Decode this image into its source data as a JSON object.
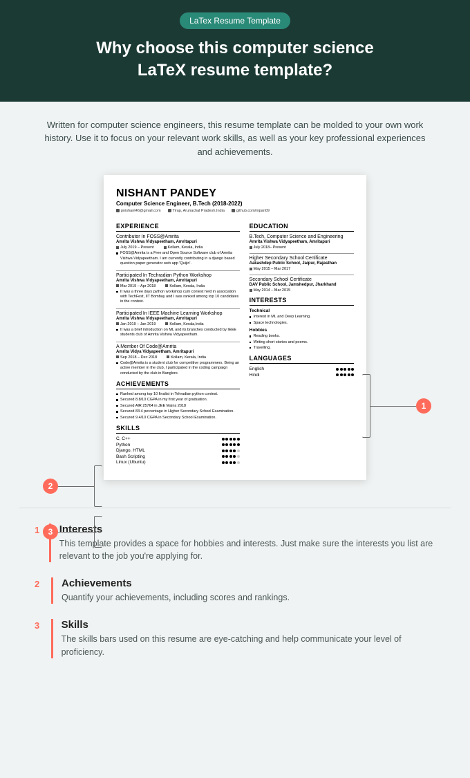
{
  "hero": {
    "badge": "LaTex Resume Template",
    "title_l1": "Why choose this computer science",
    "title_l2": "LaTeX resume template?"
  },
  "intro": "Written for computer science engineers, this resume template can be molded to your own work history. Use it to focus on your relevant work skills, as well as your key professional experiences and achievements.",
  "resume": {
    "name": "NISHANT PANDEY",
    "subtitle": "Computer Science Engineer, B.Tech (2018-2022)",
    "contact": [
      "pnishant46@gmail.com",
      "Tirap, Arunachal Pradesh,India",
      "github.com/nipan09"
    ],
    "sections": {
      "experience": "EXPERIENCE",
      "education": "EDUCATION",
      "interests": "INTERESTS",
      "languages": "LANGUAGES",
      "achievements": "ACHIEVEMENTS",
      "skills": "SKILLS"
    },
    "exp": [
      {
        "title": "Contributor In FOSS@Amrita",
        "sub": "Amrita Vishwa Vidyapeetham, Amritapuri",
        "date": "July 2019 – Present",
        "loc": "Kollam, Kerala, India",
        "bullets": [
          "FOSS@Amrita is a Free and Open Source Software club of Amrita Vishwa Vidyapeetham. I am currently contributing in a django based question paper generator web app 'Quijin'."
        ]
      },
      {
        "title": "Participated In Techradian Python Workshop",
        "sub": "Amrita Vishwa Vidyapeetham, Amritapuri",
        "date": "Mar 2019 – Apr 2018",
        "loc": "Kollam, Kerala, India",
        "bullets": [
          "It was a three days python workshop cum contest held in association with TechFest, IIT Bombay and I was ranked among top 10 candidates in the contest."
        ]
      },
      {
        "title": "Participated In IEEE Machine Learning Workshop",
        "sub": "Amrita Vishwa Vidyapeetham, Amritapuri",
        "date": "Jan 2019 – Jan 2019",
        "loc": "Kollam, Kerala,India",
        "bullets": [
          "It was a brief introduction on ML and its branches conducted by IEEE students club of Amrita Vishwa Vidyapeetham."
        ]
      },
      {
        "title": "A Member Of Code@Amrita",
        "sub": "Amrita Vidya Vidyapeetham, Amritapuri",
        "date": "Sep 2018 – Dec 2018",
        "loc": "Kollam, Kerala, India",
        "bullets": [
          "Code@Amrita is a student club for competitive programmers. Being an active member in the club, I participated in the coding campaign conducted by the club in Banglore."
        ]
      }
    ],
    "edu": [
      {
        "title": "B.Tech, Computer Science and Engineering",
        "sub": "Amrita Vishwa Vidyapeetham, Amritapuri",
        "date": "July 2018– Present"
      },
      {
        "title": "Higher Secondary School Certificate",
        "sub": "Aakashdep Public School, Jaipur, Rajasthan",
        "date": "May 2015 – Mar 2017"
      },
      {
        "title": "Secondary School Certificate",
        "sub": "DAV Public School, Jamshedpur, Jharkhand",
        "date": "May 2014 – Mar 2015"
      }
    ],
    "interests": {
      "tech_h": "Technical",
      "tech": [
        "Interest in ML and Deep Learning.",
        "Space technologies."
      ],
      "hob_h": "Hobbies",
      "hob": [
        "Reading books.",
        "Writing short stories and poems.",
        "Travelling."
      ]
    },
    "languages": [
      {
        "name": "English",
        "level": 5
      },
      {
        "name": "Hindi",
        "level": 5
      }
    ],
    "achievements": [
      "Ranked among top 10 finalist in Tehradian python contest.",
      "Secured 8.8/10 CGPA in my first year of graduation.",
      "Secured AIR 25764 in JEE Mains 2018",
      "Secured 83.4 percentage in Higher Secondary School Examination.",
      "Secured 9.4/10 CGPA in Secondary School Examination."
    ],
    "skills": [
      {
        "name": "C, C++",
        "level": 5
      },
      {
        "name": "Python",
        "level": 5
      },
      {
        "name": "Django, HTML",
        "level": 4
      },
      {
        "name": "Bash Scripting",
        "level": 4
      },
      {
        "name": "Linux (Ubuntu)",
        "level": 4
      }
    ]
  },
  "callouts": {
    "c1": "1",
    "c2": "2",
    "c3": "3"
  },
  "notes": [
    {
      "num": "1",
      "title": "Interests",
      "text": "This template provides a space for hobbies and interests. Just make sure the interests you list are relevant to the job you're applying for."
    },
    {
      "num": "2",
      "title": "Achievements",
      "text": "Quantify your achievements, including scores and rankings."
    },
    {
      "num": "3",
      "title": "Skills",
      "text": "The skills bars used on this resume are eye-catching and help communicate your level of proficiency."
    }
  ]
}
